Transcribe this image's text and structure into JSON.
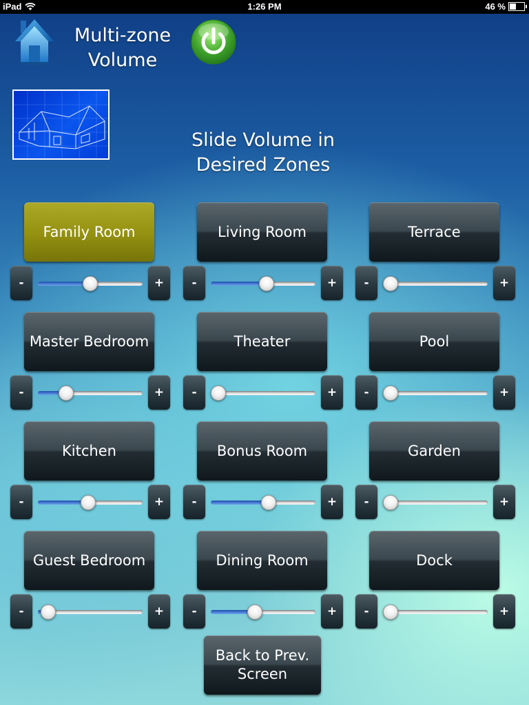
{
  "status_bar": {
    "device": "iPad",
    "time": "1:26 PM",
    "battery": "46 %",
    "battery_level": 0.46
  },
  "header": {
    "title": "Multi-zone\nVolume",
    "home_icon": "home-icon",
    "power_icon": "power-icon"
  },
  "instructions": "Slide Volume in\nDesired Zones",
  "colors": {
    "active_zone": "#979312",
    "slider_fill": "#3d78d8",
    "power_green": "#3fa22c"
  },
  "zones": [
    {
      "label": "Family Room",
      "active": true,
      "volume": 0.5,
      "minus": "-",
      "plus": "+"
    },
    {
      "label": "Living Room",
      "active": false,
      "volume": 0.54,
      "minus": "-",
      "plus": "+"
    },
    {
      "label": "Terrace",
      "active": false,
      "volume": 0.0,
      "minus": "-",
      "plus": "+"
    },
    {
      "label": "Master Bedroom",
      "active": false,
      "volume": 0.23,
      "minus": "-",
      "plus": "+"
    },
    {
      "label": "Theater",
      "active": false,
      "volume": 0.0,
      "minus": "-",
      "plus": "+"
    },
    {
      "label": "Pool",
      "active": false,
      "volume": 0.0,
      "minus": "-",
      "plus": "+"
    },
    {
      "label": "Kitchen",
      "active": false,
      "volume": 0.48,
      "minus": "-",
      "plus": "+"
    },
    {
      "label": "Bonus Room",
      "active": false,
      "volume": 0.56,
      "minus": "-",
      "plus": "+"
    },
    {
      "label": "Garden",
      "active": false,
      "volume": 0.0,
      "minus": "-",
      "plus": "+"
    },
    {
      "label": "Guest Bedroom",
      "active": false,
      "volume": 0.03,
      "minus": "-",
      "plus": "+"
    },
    {
      "label": "Dining Room",
      "active": false,
      "volume": 0.41,
      "minus": "-",
      "plus": "+"
    },
    {
      "label": "Dock",
      "active": false,
      "volume": 0.0,
      "minus": "-",
      "plus": "+"
    }
  ],
  "back_button": "Back to Prev.\nScreen"
}
